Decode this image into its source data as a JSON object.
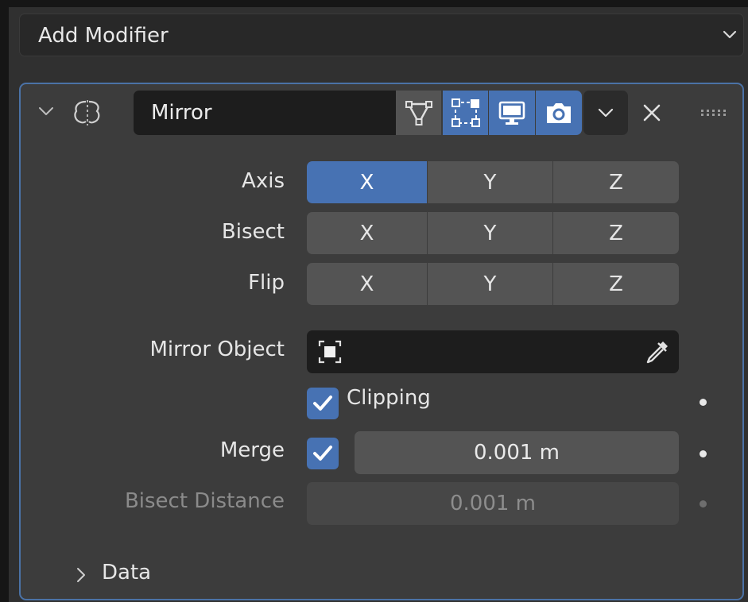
{
  "add_modifier": {
    "label": "Add Modifier",
    "icon": "chevron-down-icon"
  },
  "modifier": {
    "name": "Mirror",
    "icons": {
      "collapse": "chevron-down-icon",
      "type": "mirror-modifier-icon",
      "edit_mode": "edit-mode-icon",
      "on_cage": "on-cage-icon",
      "viewport": "viewport-display-icon",
      "render": "render-camera-icon",
      "menu": "chevron-down-icon",
      "remove": "close-icon",
      "drag": "drag-grip-icon"
    },
    "accent": "#4772b3",
    "axis": {
      "label": "Axis",
      "x": "X",
      "y": "Y",
      "z": "Z",
      "active": "X"
    },
    "bisect": {
      "label": "Bisect",
      "x": "X",
      "y": "Y",
      "z": "Z"
    },
    "flip": {
      "label": "Flip",
      "x": "X",
      "y": "Y",
      "z": "Z"
    },
    "mirror_object": {
      "label": "Mirror Object",
      "value": ""
    },
    "clipping": {
      "label": "Clipping",
      "checked": true
    },
    "merge": {
      "label": "Merge",
      "checked": true,
      "value": "0.001 m"
    },
    "bisect_distance": {
      "label": "Bisect Distance",
      "value": "0.001 m"
    },
    "data_section": {
      "label": "Data"
    }
  }
}
